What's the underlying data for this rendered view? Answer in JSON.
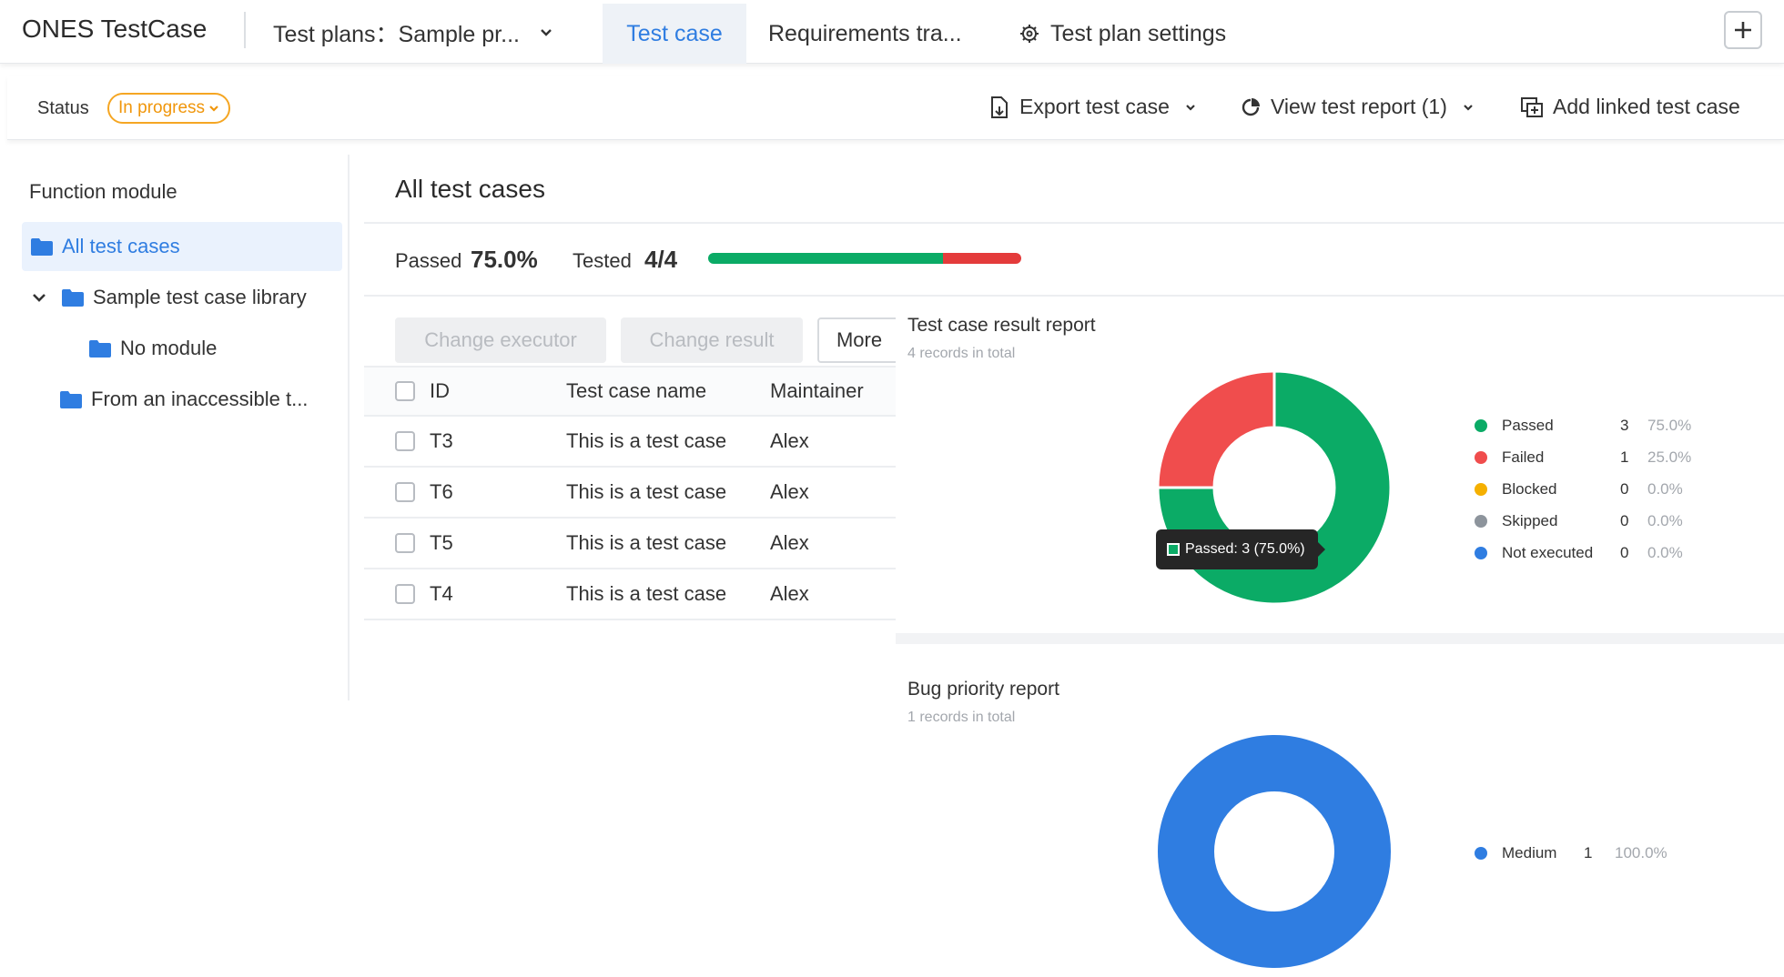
{
  "app": {
    "title": "ONES TestCase"
  },
  "header": {
    "plan_selector": "Test plans：Sample pr...",
    "tabs": [
      {
        "label": "Test case",
        "active": true
      },
      {
        "label": "Requirements tra..."
      },
      {
        "label": "Test plan settings",
        "icon": "gear-icon"
      }
    ],
    "add_icon": "plus-icon"
  },
  "status_bar": {
    "status_label": "Status",
    "status_value": "In progress",
    "actions": [
      {
        "label": "Export test case",
        "icon": "export-icon"
      },
      {
        "label": "View test report (1)",
        "icon": "report-icon"
      },
      {
        "label": "Add linked test case",
        "icon": "link-icon"
      }
    ]
  },
  "sidebar": {
    "title": "Function module",
    "items": [
      {
        "label": "All test cases",
        "selected": true
      },
      {
        "label": "Sample test case library",
        "expanded": true
      },
      {
        "label": "No module"
      },
      {
        "label": "From an inaccessible t..."
      }
    ]
  },
  "main": {
    "title": "All test cases",
    "stats": {
      "passed_label": "Passed",
      "passed_value": "75.0%",
      "tested_label": "Tested",
      "tested_value": "4/4",
      "progress_passed_fraction": 0.75,
      "progress_failed_fraction": 0.25
    },
    "buttons": {
      "change_executor": "Change executor",
      "change_result": "Change result",
      "more": "More"
    },
    "table": {
      "columns": [
        "ID",
        "Test case name",
        "Maintainer"
      ],
      "rows": [
        {
          "id": "T3",
          "name": "This is a test case",
          "maintainer": "Alex"
        },
        {
          "id": "T6",
          "name": "This is a test case",
          "maintainer": "Alex"
        },
        {
          "id": "T5",
          "name": "This is a test case",
          "maintainer": "Alex"
        },
        {
          "id": "T4",
          "name": "This is a test case",
          "maintainer": "Alex"
        }
      ]
    }
  },
  "reports": {
    "result_report": {
      "title": "Test case result report",
      "subtitle": "4 records in total",
      "tooltip": "Passed: 3 (75.0%)",
      "legend": [
        {
          "name": "Passed",
          "count": "3",
          "pct": "75.0%",
          "color": "#0bab66"
        },
        {
          "name": "Failed",
          "count": "1",
          "pct": "25.0%",
          "color": "#f04d4d"
        },
        {
          "name": "Blocked",
          "count": "0",
          "pct": "0.0%",
          "color": "#f5b000"
        },
        {
          "name": "Skipped",
          "count": "0",
          "pct": "0.0%",
          "color": "#8d949c"
        },
        {
          "name": "Not executed",
          "count": "0",
          "pct": "0.0%",
          "color": "#2f7de1"
        }
      ]
    },
    "bug_report": {
      "title": "Bug priority report",
      "subtitle": "1 records in total",
      "legend": [
        {
          "name": "Medium",
          "count": "1",
          "pct": "100.0%",
          "color": "#2f7de1"
        }
      ]
    }
  },
  "chart_data": [
    {
      "type": "pie",
      "title": "Test case result report",
      "categories": [
        "Passed",
        "Failed",
        "Blocked",
        "Skipped",
        "Not executed"
      ],
      "values": [
        3,
        1,
        0,
        0,
        0
      ],
      "colors": [
        "#0bab66",
        "#f04d4d",
        "#f5b000",
        "#8d949c",
        "#2f7de1"
      ],
      "donut": true,
      "legend": "right"
    },
    {
      "type": "pie",
      "title": "Bug priority report",
      "categories": [
        "Medium"
      ],
      "values": [
        1
      ],
      "colors": [
        "#2f7de1"
      ],
      "donut": true,
      "legend": "right"
    }
  ]
}
